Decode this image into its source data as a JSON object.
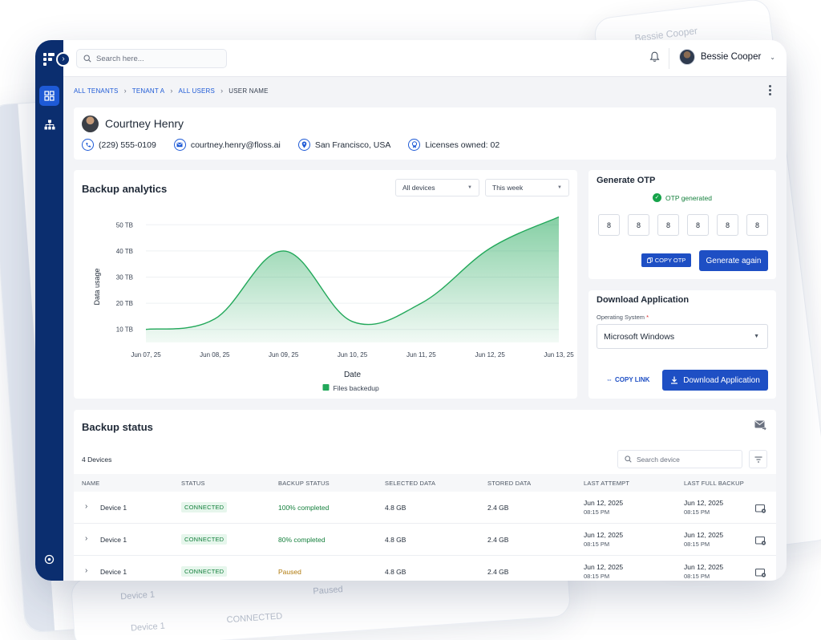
{
  "app": {
    "search_placeholder": "Search here...",
    "user_name": "Bessie Cooper"
  },
  "breadcrumb": {
    "items": [
      "ALL TENANTS",
      "TENANT A",
      "ALL USERS"
    ],
    "current": "USER NAME"
  },
  "profile": {
    "name": "Courtney Henry",
    "phone": "(229) 555-0109",
    "email": "courtney.henry@floss.ai",
    "location": "San Francisco, USA",
    "licenses": "Licenses owned: 02"
  },
  "analytics": {
    "title": "Backup analytics",
    "device_filter": "All devices",
    "period_filter": "This week"
  },
  "chart_data": {
    "type": "area",
    "x": [
      "Jun 07, 25",
      "Jun 08, 25",
      "Jun 09, 25",
      "Jun 10, 25",
      "Jun 11, 25",
      "Jun 12, 25",
      "Jun 13, 25"
    ],
    "series": [
      {
        "name": "Files backedup",
        "values": [
          10,
          14,
          40,
          13,
          20,
          41,
          53
        ]
      }
    ],
    "xlabel": "Date",
    "ylabel": "Data usage",
    "y_ticks": [
      "10 TB",
      "20 TB",
      "30 TB",
      "40 TB",
      "50 TB"
    ],
    "ylim": [
      5,
      55
    ],
    "grid": true,
    "legend": "bottom-center",
    "color": "#22a85a"
  },
  "otp": {
    "title": "Generate OTP",
    "status": "OTP generated",
    "digits": [
      "8",
      "8",
      "8",
      "8",
      "8",
      "8"
    ],
    "copy_label": "COPY OTP",
    "generate_label": "Generate again"
  },
  "download": {
    "title": "Download Application",
    "os_label": "Operating System",
    "required_mark": "*",
    "os_value": "Microsoft Windows",
    "copy_link_label": "COPY LINK",
    "button_label": "Download Application"
  },
  "backup_status": {
    "title": "Backup status",
    "device_count": "4 Devices",
    "search_placeholder": "Search device",
    "columns": [
      "NAME",
      "STATUS",
      "BACKUP STATUS",
      "SELECTED DATA",
      "STORED DATA",
      "LAST ATTEMPT",
      "LAST FULL BACKUP"
    ],
    "rows": [
      {
        "name": "Device 1",
        "status": "CONNECTED",
        "backup_status": "100% completed",
        "selected": "4.8 GB",
        "stored": "2.4 GB",
        "last_attempt_date": "Jun 12, 2025",
        "last_attempt_time": "08:15 PM",
        "last_full_date": "Jun 12, 2025",
        "last_full_time": "08:15 PM"
      },
      {
        "name": "Device 1",
        "status": "CONNECTED",
        "backup_status": "80% completed",
        "selected": "4.8 GB",
        "stored": "2.4 GB",
        "last_attempt_date": "Jun 12, 2025",
        "last_attempt_time": "08:15 PM",
        "last_full_date": "Jun 12, 2025",
        "last_full_time": "08:15 PM"
      },
      {
        "name": "Device 1",
        "status": "CONNECTED",
        "backup_status": "Paused",
        "selected": "4.8 GB",
        "stored": "2.4 GB",
        "last_attempt_date": "Jun 12, 2025",
        "last_attempt_time": "08:15 PM",
        "last_full_date": "Jun 12, 2025",
        "last_full_time": "08:15 PM"
      }
    ]
  },
  "colors": {
    "accent": "#1e4fc4",
    "sidebar": "#0b2e6f",
    "success": "#15803d",
    "paused": "#b07a0c"
  },
  "ghost": {
    "user_name": "Bessie Cooper",
    "device_labels": [
      "Device 1",
      "Device 1"
    ],
    "status_label": "CONNECTED",
    "paused_label": "Paused"
  }
}
